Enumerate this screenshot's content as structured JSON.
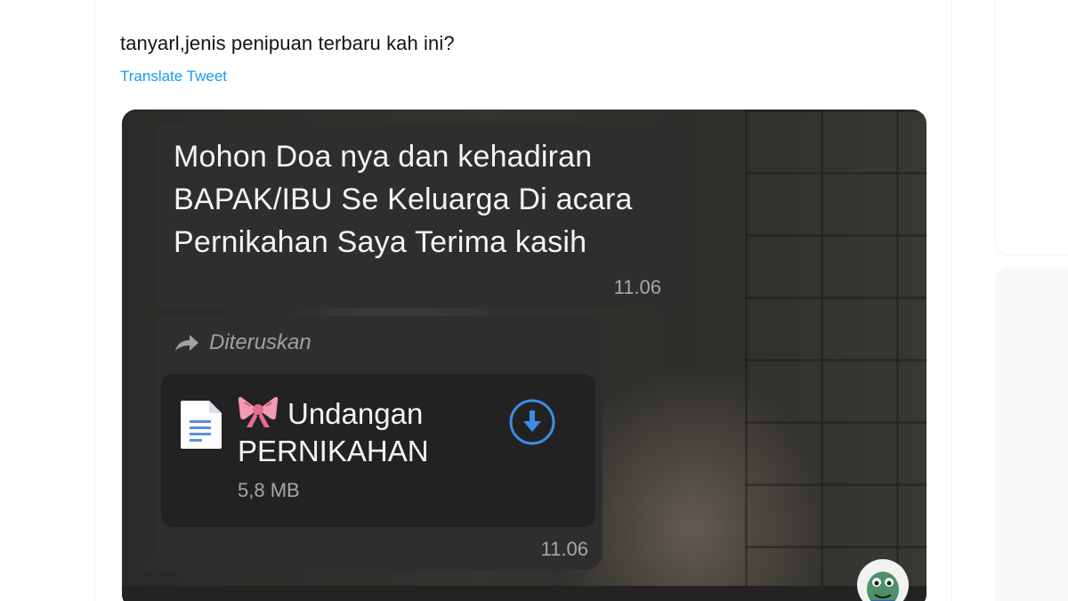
{
  "tweet": {
    "text": "tanyarl,jenis penipuan terbaru kah ini?",
    "translate_label": "Translate Tweet"
  },
  "chat": {
    "message_1": {
      "lines": [
        "Mohon Doa nya dan kehadiran",
        "BAPAK/IBU Se Keluarga Di acara",
        "Pernikahan Saya Terima kasih"
      ],
      "time": "11.06"
    },
    "message_2": {
      "forwarded_label": "Diteruskan",
      "forward_icon": "forward-arrow-icon",
      "file": {
        "icon": "document-icon",
        "emoji_icon": "ribbon-bow-icon",
        "title_line_1": "Undangan",
        "title_line_2": "PERNIKAHAN",
        "size": "5,8 MB",
        "action_icon": "download-icon"
      },
      "time": "11.06"
    }
  },
  "colors": {
    "link": "#1d9bf0",
    "bubble": "#2e2e2e",
    "file_card": "#222222",
    "download_accent": "#3b8ee8"
  }
}
